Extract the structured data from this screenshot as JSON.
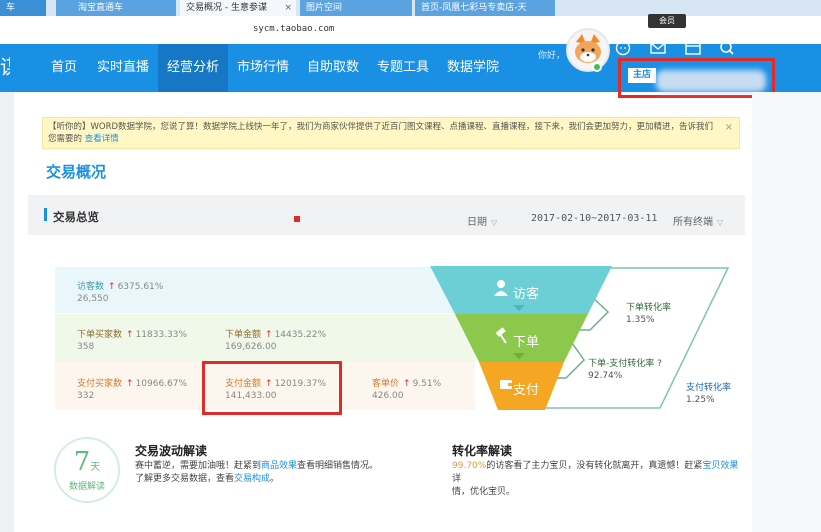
{
  "browser": {
    "tabs": [
      {
        "label": "车"
      },
      {
        "label": "淘宝直通车"
      },
      {
        "label": "交易概况 - 生意参谋"
      },
      {
        "label": "图片空间"
      },
      {
        "label": "首页-凤凰七彩马专卖店-天"
      }
    ],
    "active_tab_close": "×",
    "url": "sycm.taobao.com",
    "tooltip": "会员"
  },
  "nav": {
    "logo_char": "谋",
    "items": [
      {
        "label": "首页"
      },
      {
        "label": "实时直播"
      },
      {
        "label": "经营分析"
      },
      {
        "label": "市场行情"
      },
      {
        "label": "自助取数"
      },
      {
        "label": "专题工具"
      },
      {
        "label": "数据学院"
      }
    ],
    "greeting": "你好，",
    "shop_tag": "主店"
  },
  "notice": {
    "text": "【听你的】WORD数据学院，您说了算！数据学院上线快一年了，我们为商家伙伴提供了近百门图文课程、点播课程、直播课程，接下来，我们会更加努力，更加精进，告诉我们您需要的",
    "link": "查看详情",
    "close": "×"
  },
  "page_title": "交易概况",
  "overview": {
    "title": "交易总览",
    "date_label": "日期",
    "date_range": "2017-02-10~2017-03-11",
    "terminal": "所有终端"
  },
  "metrics": {
    "visitors": {
      "label": "访客数",
      "arrow": "↑",
      "change": "6375.61%",
      "value": "26,550"
    },
    "order_buyers": {
      "label": "下单买家数",
      "arrow": "↑",
      "change": "11833.33%",
      "value": "358"
    },
    "order_amount": {
      "label": "下单金额",
      "arrow": "↑",
      "change": "14435.22%",
      "value": "169,626.00"
    },
    "pay_buyers": {
      "label": "支付买家数",
      "arrow": "↑",
      "change": "10966.67%",
      "value": "332"
    },
    "pay_amount": {
      "label": "支付金额",
      "arrow": "↑",
      "change": "12019.37%",
      "value": "141,433.00"
    },
    "avg_price": {
      "label": "客单价",
      "arrow": "↑",
      "change": "9.51%",
      "value": "426.00"
    }
  },
  "funnel": {
    "visit": "访客",
    "order": "下单",
    "pay": "支付"
  },
  "rates": {
    "order_conversion": {
      "label": "下单转化率",
      "value": "1.35%"
    },
    "order_pay_conversion": {
      "label": "下单-支付转化率",
      "value": "92.74%"
    },
    "pay_conversion": {
      "label": "支付转化率",
      "value": "1.25%"
    }
  },
  "colors": {
    "brand": "#1a90e5",
    "visit": "#6ccfd6",
    "order": "#8cc84b",
    "pay": "#f5a623",
    "highlight": "#e12b2b"
  },
  "badge": {
    "num": "7",
    "unit": "天",
    "text": "数据解读"
  },
  "cards": {
    "volatility": {
      "title": "交易波动解读",
      "line1_pre": "赛中蓄逆，需要加油哦！赶紧到",
      "line1_link": "商品效果",
      "line1_post": "查看明细销售情况。",
      "line2_pre": "了解更多交易数据，查看",
      "line2_link": "交易构成",
      "line2_post": "。"
    },
    "conversion": {
      "title": "转化率解读",
      "pct": "99.70%",
      "line1": "的访客看了主力宝贝，没有转化就离开，真遗憾！赶紧",
      "link": "宝贝效果",
      "line1_post": "详",
      "line2": "情，优化宝贝。"
    }
  }
}
